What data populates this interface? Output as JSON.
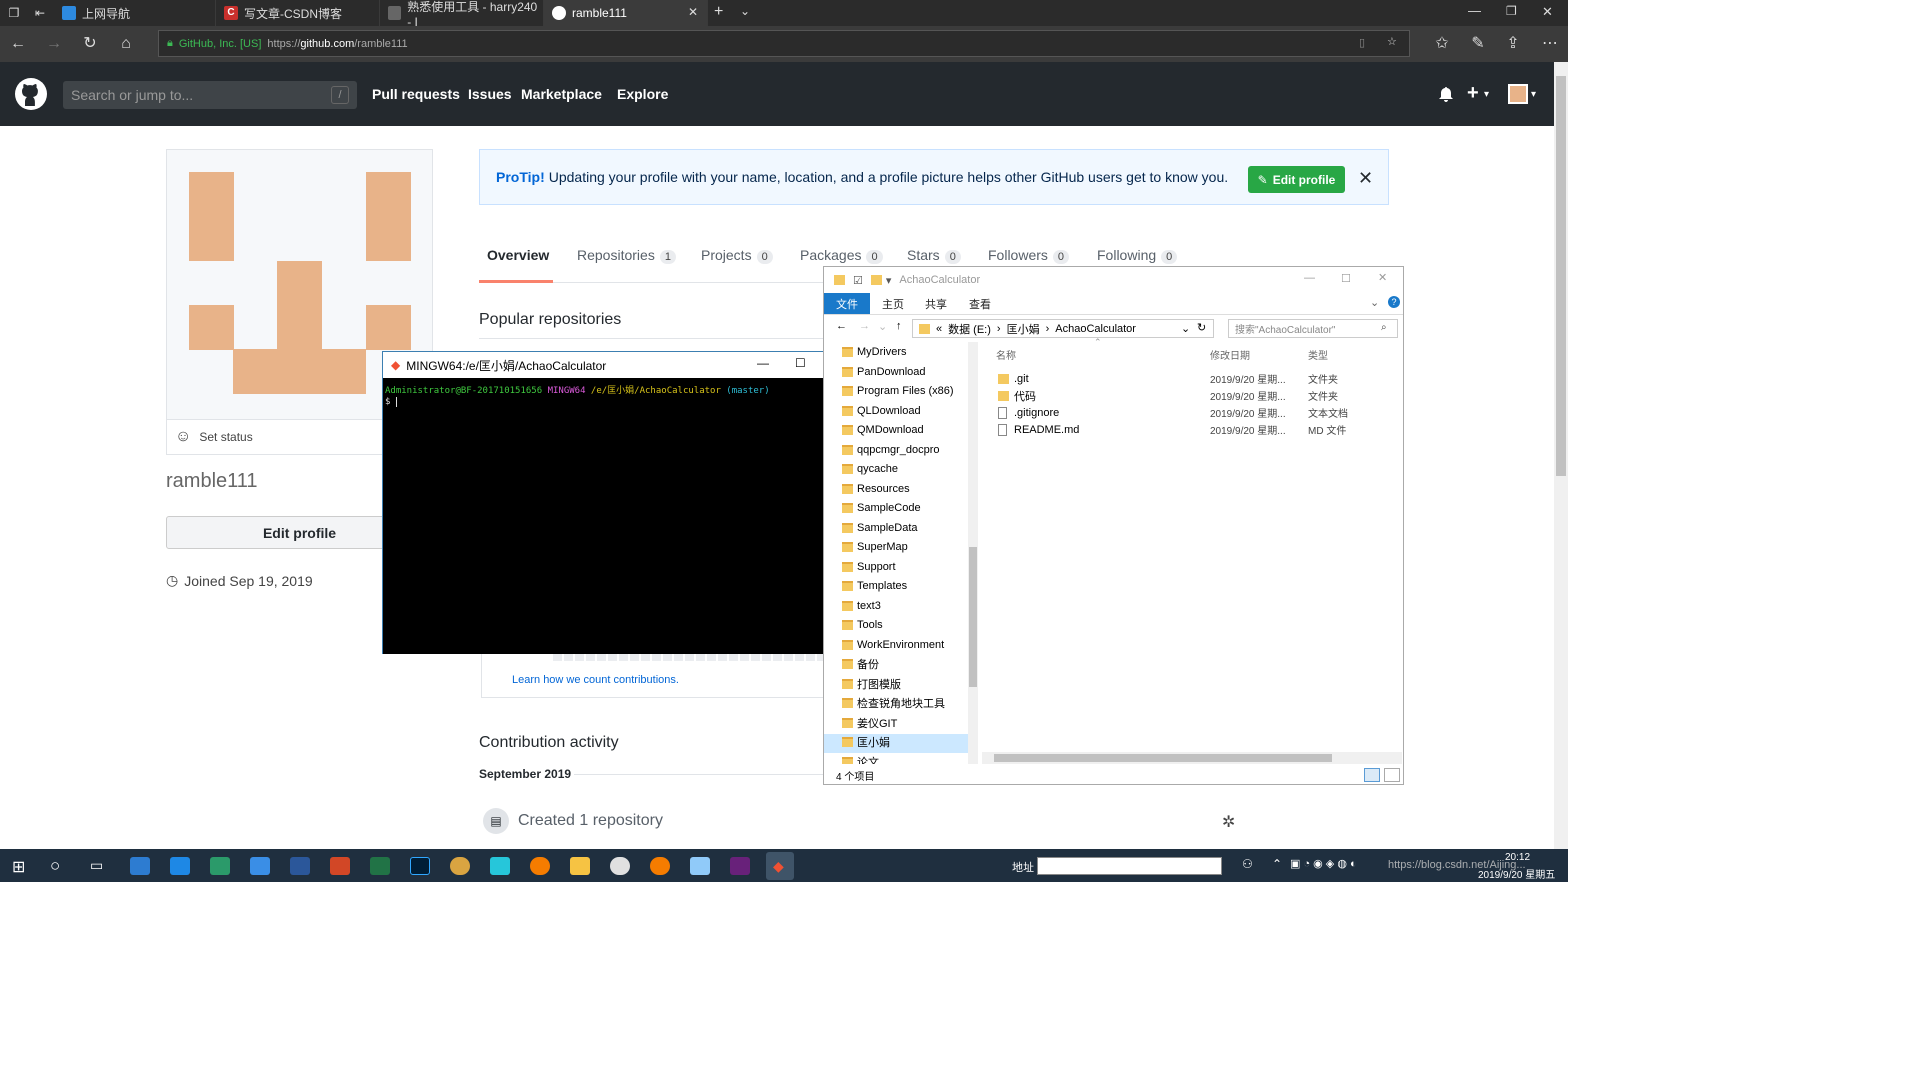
{
  "browser": {
    "tabs": [
      {
        "label": "上网导航",
        "color": "#2d8ae0",
        "active": false
      },
      {
        "label": "写文章-CSDN博客",
        "color": "#c9302c",
        "active": false
      },
      {
        "label": "熟悉使用工具 - harry240 - I",
        "color": "#666666",
        "active": false
      },
      {
        "label": "ramble111",
        "color": "#ffffff",
        "active": true
      }
    ],
    "cert": "GitHub, Inc. [US]",
    "url_prefix": "https://",
    "url_host": "github.com",
    "url_path": "/ramble111"
  },
  "header": {
    "search_placeholder": "Search or jump to...",
    "search_shortcut": "/",
    "nav": [
      "Pull requests",
      "Issues",
      "Marketplace",
      "Explore"
    ],
    "plus": "+",
    "caret": "▾"
  },
  "profile": {
    "set_status": "Set status",
    "username": "ramble111",
    "edit_profile": "Edit profile",
    "joined": "Joined Sep 19, 2019"
  },
  "protip": {
    "label": "ProTip!",
    "text": "Updating your profile with your name, location, and a profile picture helps other GitHub users get to know you.",
    "button": "Edit profile",
    "close": "✕"
  },
  "tabs": [
    {
      "label": "Overview",
      "count": ""
    },
    {
      "label": "Repositories",
      "count": "1"
    },
    {
      "label": "Projects",
      "count": "0"
    },
    {
      "label": "Packages",
      "count": "0"
    },
    {
      "label": "Stars",
      "count": "0"
    },
    {
      "label": "Followers",
      "count": "0"
    },
    {
      "label": "Following",
      "count": "0"
    }
  ],
  "sections": {
    "popular": "Popular repositories",
    "learn": "Learn how we count contributions.",
    "activity": "Contribution activity",
    "month": "September 2019",
    "created": "Created 1 repository"
  },
  "terminal": {
    "title": "MINGW64:/e/匡小娟/AchaoCalculator",
    "user": "Administrator@BF-201710151656",
    "shell": "MINGW64",
    "path": "/e/匡小娟/AchaoCalculator",
    "branch": "(master)",
    "prompt": "$"
  },
  "explorer": {
    "title": "AchaoCalculator",
    "ribbon": [
      "文件",
      "主页",
      "共享",
      "查看"
    ],
    "crumbs": [
      "«",
      "数据 (E:)",
      "›",
      "匡小娟",
      "›",
      "AchaoCalculator"
    ],
    "search_placeholder": "搜索\"AchaoCalculator\"",
    "tree": [
      "MyDrivers",
      "PanDownload",
      "Program Files (x86)",
      "QLDownload",
      "QMDownload",
      "qqpcmgr_docpro",
      "qycache",
      "Resources",
      "SampleCode",
      "SampleData",
      "SuperMap",
      "Support",
      "Templates",
      "text3",
      "Tools",
      "WorkEnvironment",
      "备份",
      "打图模版",
      "检查锐角地块工具",
      "姜仪GIT",
      "匡小娟",
      "论文"
    ],
    "tree_selected": "匡小娟",
    "columns": [
      "名称",
      "修改日期",
      "类型"
    ],
    "files": [
      {
        "name": ".git",
        "date": "2019/9/20 星期...",
        "type": "文件夹",
        "kind": "folder"
      },
      {
        "name": "代码",
        "date": "2019/9/20 星期...",
        "type": "文件夹",
        "kind": "folder"
      },
      {
        "name": ".gitignore",
        "date": "2019/9/20 星期...",
        "type": "文本文档",
        "kind": "file"
      },
      {
        "name": "README.md",
        "date": "2019/9/20 星期...",
        "type": "MD 文件",
        "kind": "file"
      }
    ],
    "status": "4 个项目"
  },
  "taskbar": {
    "addr_label": "地址",
    "time": "20:12",
    "date": "2019/9/20 星期五",
    "watermark": "https://blog.csdn.net/Aijing..."
  },
  "colors": {
    "github_header": "#24292e",
    "accent_green": "#28a745",
    "avatar": "#e8b389",
    "tab_underline": "#f9826c"
  }
}
